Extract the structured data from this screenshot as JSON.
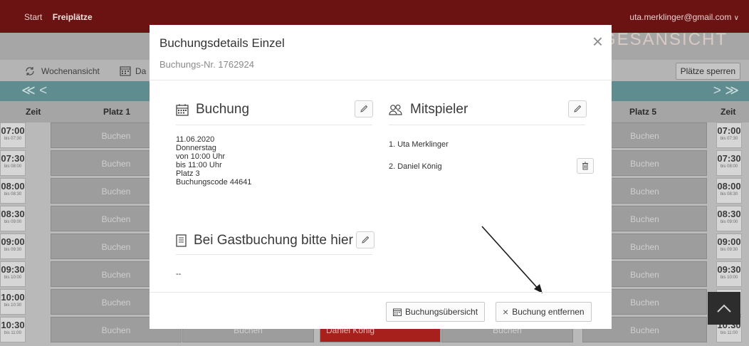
{
  "nav": {
    "start": "Start",
    "freiplaetze": "Freiplätze",
    "user_email": "uta.merklinger@gmail.com",
    "user_chevron": "∨",
    "brand": "TAGESANSICHT"
  },
  "toolbar": {
    "week_view": "Wochenansicht",
    "day_view_partial": "Da",
    "lock_courts": "Plätze sperren"
  },
  "navrow": {
    "prev": "≪ <",
    "next": "> ≫"
  },
  "grid": {
    "header": {
      "time": "Zeit",
      "court1": "Platz 1",
      "court5": "Platz 5",
      "time_right": "Zeit"
    },
    "slot_label": "Buchen",
    "booked_name": "Daniel König",
    "rows": [
      {
        "time": "07:00",
        "until": "bis 07:30"
      },
      {
        "time": "07:30",
        "until": "bis 08:00"
      },
      {
        "time": "08:00",
        "until": "bis 08:30"
      },
      {
        "time": "08:30",
        "until": "bis 09:00"
      },
      {
        "time": "09:00",
        "until": "bis 09:30"
      },
      {
        "time": "09:30",
        "until": "bis 10:00"
      },
      {
        "time": "10:00",
        "until": "bis 10:30"
      },
      {
        "time": "10:30",
        "until": "bis 11:00"
      }
    ]
  },
  "modal": {
    "title": "Buchungsdetails Einzel",
    "subtitle": "Buchungs-Nr. 1762924",
    "close": "×",
    "booking": {
      "heading": "Buchung",
      "date": "11.06.2020",
      "weekday": "Donnerstag",
      "from": "von 10:00 Uhr",
      "to": "bis 11:00 Uhr",
      "court": "Platz 3",
      "code": "Buchungscode 44641"
    },
    "players": {
      "heading": "Mitspieler",
      "list": [
        "1. Uta Merklinger",
        "2. Daniel König"
      ]
    },
    "guest": {
      "heading": "Bei Gastbuchung bitte hier ...",
      "value": "--"
    },
    "footer": {
      "overview": "Buchungsübersicht",
      "remove": "Buchung entfernen",
      "remove_icon": "×"
    }
  },
  "colors": {
    "topbar": "#6b1312",
    "booked": "#a8201c",
    "navrow": "#5f8d8f"
  }
}
